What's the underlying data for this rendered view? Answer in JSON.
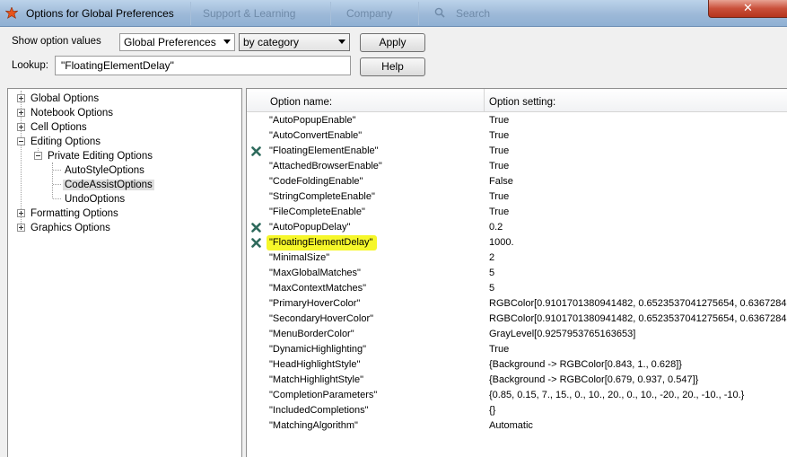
{
  "window": {
    "title": "Options for Global Preferences",
    "background_tabs": [
      "Support & Learning",
      "Company"
    ],
    "background_search": "Search",
    "close_glyph": "✕"
  },
  "controls": {
    "show_values_label": "Show option values",
    "scope_select": "Global Preferences",
    "view_select": "by category",
    "apply_label": "Apply",
    "lookup_label": "Lookup:",
    "lookup_value": "\"FloatingElementDelay\"",
    "help_label": "Help"
  },
  "tree": [
    {
      "label": "Global Options",
      "level": 0,
      "expander": "plus"
    },
    {
      "label": "Notebook Options",
      "level": 0,
      "expander": "plus"
    },
    {
      "label": "Cell Options",
      "level": 0,
      "expander": "plus"
    },
    {
      "label": "Editing Options",
      "level": 0,
      "expander": "minus"
    },
    {
      "label": "Private Editing Options",
      "level": 1,
      "expander": "minus"
    },
    {
      "label": "AutoStyleOptions",
      "level": 2,
      "expander": "none"
    },
    {
      "label": "CodeAssistOptions",
      "level": 2,
      "expander": "none",
      "selected": true
    },
    {
      "label": "UndoOptions",
      "level": 2,
      "expander": "none"
    },
    {
      "label": "Formatting Options",
      "level": 0,
      "expander": "plus"
    },
    {
      "label": "Graphics Options",
      "level": 0,
      "expander": "plus"
    }
  ],
  "table": {
    "col_name": "Option name:",
    "col_setting": "Option setting:",
    "highlight_color": "#f6f72a",
    "reset_icon_color": "#2e6a5c",
    "rows": [
      {
        "name": "\"AutoPopupEnable\"",
        "value": "True",
        "reset": false
      },
      {
        "name": "\"AutoConvertEnable\"",
        "value": "True",
        "reset": false
      },
      {
        "name": "\"FloatingElementEnable\"",
        "value": "True",
        "reset": true
      },
      {
        "name": "\"AttachedBrowserEnable\"",
        "value": "True",
        "reset": false
      },
      {
        "name": "\"CodeFoldingEnable\"",
        "value": "False",
        "reset": false
      },
      {
        "name": "\"StringCompleteEnable\"",
        "value": "True",
        "reset": false
      },
      {
        "name": "\"FileCompleteEnable\"",
        "value": "True",
        "reset": false
      },
      {
        "name": "\"AutoPopupDelay\"",
        "value": "0.2",
        "reset": true
      },
      {
        "name": "\"FloatingElementDelay\"",
        "value": "1000.",
        "reset": true,
        "highlighted": true
      },
      {
        "name": "\"MinimalSize\"",
        "value": "2",
        "reset": false
      },
      {
        "name": "\"MaxGlobalMatches\"",
        "value": "5",
        "reset": false
      },
      {
        "name": "\"MaxContextMatches\"",
        "value": "5",
        "reset": false
      },
      {
        "name": "\"PrimaryHoverColor\"",
        "value": "RGBColor[0.9101701380941482, 0.6523537041275654, 0.63672846",
        "reset": false
      },
      {
        "name": "\"SecondaryHoverColor\"",
        "value": "RGBColor[0.9101701380941482, 0.6523537041275654, 0.63672846",
        "reset": false
      },
      {
        "name": "\"MenuBorderColor\"",
        "value": "GrayLevel[0.9257953765163653]",
        "reset": false
      },
      {
        "name": "\"DynamicHighlighting\"",
        "value": "True",
        "reset": false
      },
      {
        "name": "\"HeadHighlightStyle\"",
        "value": "{Background -> RGBColor[0.843, 1., 0.628]}",
        "reset": false
      },
      {
        "name": "\"MatchHighlightStyle\"",
        "value": "{Background -> RGBColor[0.679, 0.937, 0.547]}",
        "reset": false
      },
      {
        "name": "\"CompletionParameters\"",
        "value": "{0.85, 0.15, 7., 15., 0., 10., 20., 0., 10., -20., 20., -10., -10.}",
        "reset": false
      },
      {
        "name": "\"IncludedCompletions\"",
        "value": "{}",
        "reset": false
      },
      {
        "name": "\"MatchingAlgorithm\"",
        "value": "Automatic",
        "reset": false
      }
    ]
  }
}
